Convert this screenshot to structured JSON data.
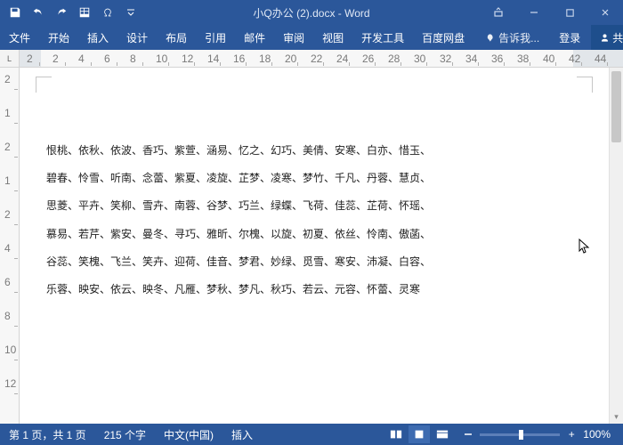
{
  "title": "小Q办公 (2).docx - Word",
  "tabs": {
    "file": "文件",
    "home": "开始",
    "insert": "插入",
    "design": "设计",
    "layout": "布局",
    "references": "引用",
    "mailings": "邮件",
    "review": "审阅",
    "view": "视图",
    "developer": "开发工具",
    "baidu": "百度网盘",
    "tell": "告诉我...",
    "login": "登录",
    "share": "共享"
  },
  "ruler_corner": "L",
  "hruler": [
    "2",
    "2",
    "4",
    "6",
    "8",
    "10",
    "12",
    "14",
    "16",
    "18",
    "20",
    "22",
    "24",
    "26",
    "28",
    "30",
    "32",
    "34",
    "36",
    "38",
    "40",
    "42",
    "44"
  ],
  "vruler": [
    "2",
    "1",
    "2",
    "1",
    "2",
    "4",
    "6",
    "8",
    "10",
    "12"
  ],
  "lines": [
    "恨桃、依秋、依波、香巧、紫萱、涵易、忆之、幻巧、美倩、安寒、白亦、惜玉、",
    "碧春、怜雪、听南、念蕾、紫夏、凌旋、芷梦、凌寒、梦竹、千凡、丹蓉、慧贞、",
    "思菱、平卉、笑柳、雪卉、南蓉、谷梦、巧兰、绿蝶、飞荷、佳蕊、芷荷、怀瑶、",
    "慕易、若芹、紫安、曼冬、寻巧、雅昕、尔槐、以旋、初夏、依丝、怜南、傲菡、",
    "谷蕊、笑槐、飞兰、笑卉、迎荷、佳音、梦君、妙绿、觅雪、寒安、沛凝、白容、",
    "乐蓉、映安、依云、映冬、凡雁、梦秋、梦凡、秋巧、若云、元容、怀蕾、灵寒"
  ],
  "status": {
    "page": "第 1 页，共 1 页",
    "words": "215 个字",
    "lang": "中文(中国)",
    "mode": "插入"
  },
  "zoom": {
    "value": "100%",
    "plus": "+"
  }
}
